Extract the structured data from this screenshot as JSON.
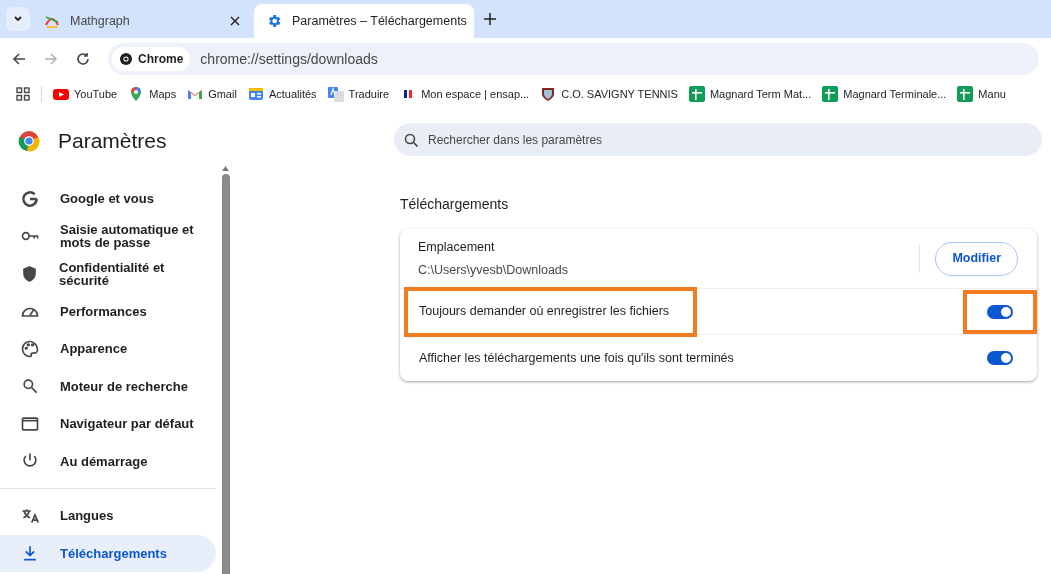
{
  "tabs": [
    {
      "title": "Mathgraph",
      "selected": false,
      "kind": "mathgraph"
    },
    {
      "title": "Paramètres – Téléchargements",
      "selected": true,
      "kind": "settings"
    }
  ],
  "address_bar": {
    "chip": "Chrome",
    "url": "chrome://settings/downloads"
  },
  "bookmarks": [
    {
      "label": "YouTube",
      "kind": "youtube"
    },
    {
      "label": "Maps",
      "kind": "maps"
    },
    {
      "label": "Gmail",
      "kind": "gmail"
    },
    {
      "label": "Actualités",
      "kind": "news"
    },
    {
      "label": "Traduire",
      "kind": "translate"
    },
    {
      "label": "Mon espace | ensap...",
      "kind": "flag"
    },
    {
      "label": "C.O. SAVIGNY TENNIS",
      "kind": "crest"
    },
    {
      "label": "Magnard Term Mat...",
      "kind": "sheet"
    },
    {
      "label": "Magnard Terminale...",
      "kind": "sheet"
    },
    {
      "label": "Manu",
      "kind": "sheet"
    }
  ],
  "sidebar": {
    "title": "Paramètres",
    "items": [
      {
        "label": "Google et vous",
        "kind": "google",
        "selected": false
      },
      {
        "label": "Saisie automatique et\nmots de passe",
        "kind": "key",
        "selected": false
      },
      {
        "label": "Confidentialité et sécurité",
        "kind": "shield",
        "selected": false
      },
      {
        "label": "Performances",
        "kind": "gauge",
        "selected": false
      },
      {
        "label": "Apparence",
        "kind": "palette",
        "selected": false
      },
      {
        "label": "Moteur de recherche",
        "kind": "search",
        "selected": false
      },
      {
        "label": "Navigateur par défaut",
        "kind": "window",
        "selected": false
      },
      {
        "label": "Au démarrage",
        "kind": "power",
        "selected": false
      },
      {
        "label": "Langues",
        "kind": "translate",
        "selected": false,
        "divider_before": true
      },
      {
        "label": "Téléchargements",
        "kind": "download",
        "selected": true
      }
    ]
  },
  "search": {
    "placeholder": "Rechercher dans les paramètres"
  },
  "section": {
    "title": "Téléchargements",
    "location": {
      "label": "Emplacement",
      "path": "C:\\Users\\yvesb\\Downloads",
      "button": "Modifier"
    },
    "settings": [
      {
        "label": "Toujours demander où enregistrer les fichiers",
        "on": true,
        "label_highlighted": true,
        "toggle_highlighted": true
      },
      {
        "label": "Afficher les téléchargements une fois qu'ils sont terminés",
        "on": true,
        "label_highlighted": false,
        "toggle_highlighted": false
      }
    ]
  }
}
